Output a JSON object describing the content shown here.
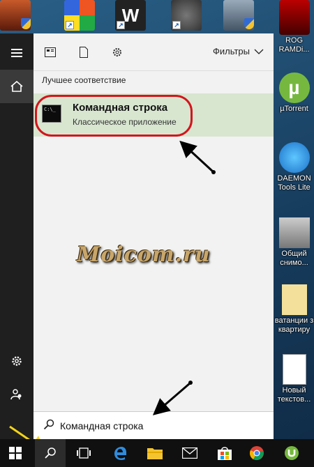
{
  "search": {
    "filters_label": "Фильтры",
    "best_match_heading": "Лучшее соответствие",
    "query": "Командная строка"
  },
  "best_match": {
    "title": "Командная строка",
    "subtitle": "Классическое приложение",
    "icon_text": "C:\\_"
  },
  "watermark": "Moicom.ru",
  "desktop_icons": [
    {
      "label": "ROG\nRAMDi..."
    },
    {
      "label": "µTorrent"
    },
    {
      "label": "DAEMON\nTools Lite"
    },
    {
      "label": "Общий\nснимо..."
    },
    {
      "label": "ватанции з\nквартиру"
    },
    {
      "label": "Новый\nтекстов..."
    }
  ],
  "colors": {
    "accent_green": "#d8e6d0",
    "highlight_red": "#d4141c",
    "arrow_yellow": "#f2d31a"
  }
}
